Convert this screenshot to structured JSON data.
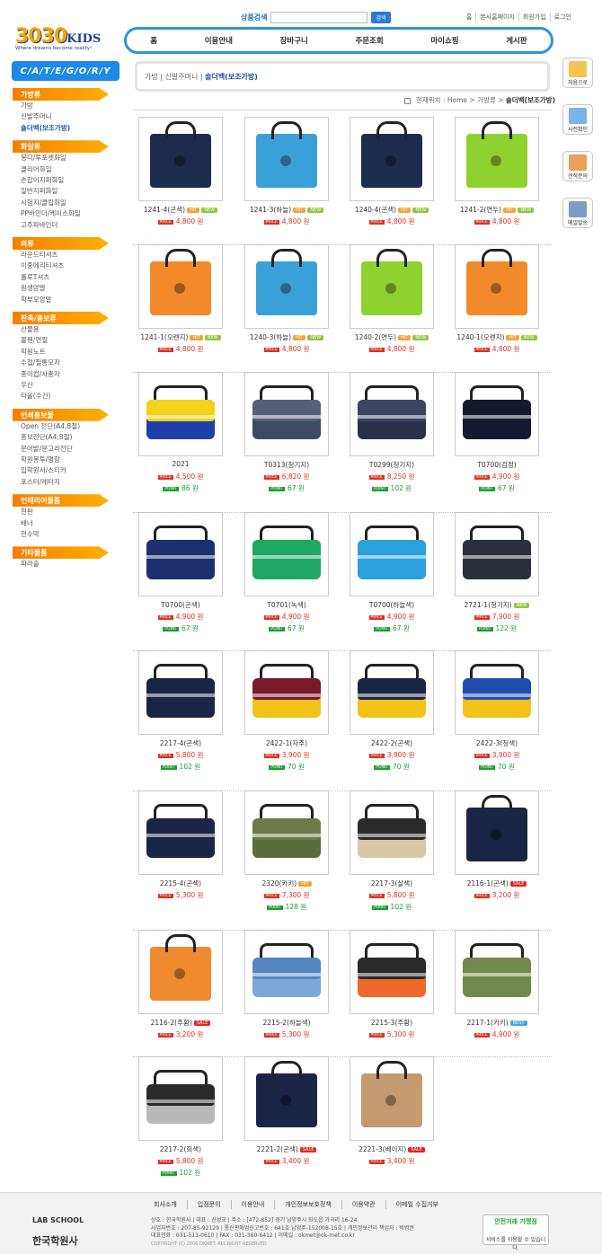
{
  "header": {
    "logo_main": "3030",
    "logo_kids": "KIDS",
    "logo_tagline": "Where dreams become reality!",
    "search_label": "상품검색",
    "search_button": "검색",
    "top_links": [
      "홈",
      "본사홈페이지",
      "회원가입",
      "로그인"
    ],
    "nav": [
      "홈",
      "이용안내",
      "장바구니",
      "주문조회",
      "마이쇼핑",
      "게시판"
    ]
  },
  "sidebar": {
    "category_title": "C/A/T/E/G/O/R/Y",
    "groups": [
      {
        "title": "가방류",
        "items": [
          "가방",
          "신발주머니",
          "숄더백(보조가방)"
        ]
      },
      {
        "title": "화일류",
        "items": [
          "봉디/투포켓화일",
          "클리어화일",
          "손잡이지퍼화일",
          "일반지퍼화일",
          "시험지/클립화일",
          "PP바인더/케이스화일",
          "고주파바인더"
        ]
      },
      {
        "title": "의류",
        "items": [
          "라운드티셔츠",
          "이중에리티셔츠",
          "롤루T셔츠",
          "원생앙말",
          "학부모앙말"
        ]
      },
      {
        "title": "판촉/홍보류",
        "items": [
          "산물용",
          "볼펜/연필",
          "학원노트",
          "수첩/필통모자",
          "종이컵/사총자",
          "우산",
          "타올(수건)"
        ]
      },
      {
        "title": "인쇄홍보물",
        "items": [
          "Open 전단(A4,8절)",
          "홍보전단(A4,8절)",
          "문어발/문고리전단",
          "학원봉투/명함",
          "입학원서/스티커",
          "포스터/레터지"
        ]
      },
      {
        "title": "인테리어물품",
        "items": [
          "현판",
          "배너",
          "현수막"
        ]
      },
      {
        "title": "기타물품",
        "items": [
          "파라솔"
        ]
      }
    ]
  },
  "quick": [
    "처음으로",
    "사전확인",
    "견적문의",
    "메일발송"
  ],
  "location": {
    "path": "가방 | 신발주머니 |",
    "current": "숄더백(보조가방)"
  },
  "breadcrumb": {
    "label": "현재위치 :",
    "path": "Home > 가방류 >",
    "current": "숄더백(보조가방)"
  },
  "products": [
    {
      "name": "1241-4(곤색)",
      "tags": [
        "hit",
        "new"
      ],
      "price": "4,800 원",
      "color": "#1d2b4d",
      "kind": "tote"
    },
    {
      "name": "1241-3(하늘)",
      "tags": [
        "hit",
        "new"
      ],
      "price": "4,800 원",
      "color": "#3aa0d8",
      "kind": "tote"
    },
    {
      "name": "1240-4(곤색)",
      "tags": [
        "hit",
        "new"
      ],
      "price": "4,800 원",
      "color": "#1d2b4d",
      "kind": "tote"
    },
    {
      "name": "1241-2(연두)",
      "tags": [
        "hit",
        "new"
      ],
      "price": "4,800 원",
      "color": "#8fd12e",
      "kind": "tote"
    },
    {
      "name": "1241-1(오렌지)",
      "tags": [
        "hit",
        "new"
      ],
      "price": "4,800 원",
      "color": "#f28a2c",
      "kind": "tote"
    },
    {
      "name": "1240-3(하늘)",
      "tags": [
        "hit",
        "new"
      ],
      "price": "4,800 원",
      "color": "#3aa0d8",
      "kind": "tote"
    },
    {
      "name": "1240-2(연두)",
      "tags": [
        "hit",
        "new"
      ],
      "price": "4,800 원",
      "color": "#8fd12e",
      "kind": "tote"
    },
    {
      "name": "1240-1(오렌지)",
      "tags": [
        "hit",
        "new"
      ],
      "price": "4,800 원",
      "color": "#f28a2c",
      "kind": "tote"
    },
    {
      "name": "2021",
      "tags": [],
      "price": "4,500 원",
      "point": "86 원",
      "color": "#1f3fa8",
      "color2": "#f3d21c",
      "kind": "msg"
    },
    {
      "name": "T0313(청기지)",
      "tags": [],
      "price": "6,820 원",
      "point": "67 원",
      "color": "#3d4a63",
      "color2": "#555f78",
      "kind": "msg"
    },
    {
      "name": "T0299(청기지)",
      "tags": [],
      "price": "8,250 원",
      "point": "102 원",
      "color": "#2a3147",
      "color2": "#3b4460",
      "kind": "msg"
    },
    {
      "name": "T0700(검정)",
      "tags": [],
      "price": "4,900 원",
      "point": "67 원",
      "color": "#141b30",
      "color2": "#141b30",
      "kind": "msg"
    },
    {
      "name": "T0700(곤색)",
      "tags": [],
      "price": "4,900 원",
      "point": "67 원",
      "color": "#1c2f6e",
      "color2": "#1c2f6e",
      "kind": "msg"
    },
    {
      "name": "T0701(녹색)",
      "tags": [],
      "price": "4,900 원",
      "point": "67 원",
      "color": "#1fa864",
      "color2": "#1fa864",
      "kind": "msg"
    },
    {
      "name": "T0700(하늘색)",
      "tags": [],
      "price": "4,900 원",
      "point": "67 원",
      "color": "#2aa0dc",
      "color2": "#2aa0dc",
      "kind": "msg"
    },
    {
      "name": "2721-1(청기지)",
      "tags": [
        "new"
      ],
      "price": "7,900 원",
      "point": "122 원",
      "color": "#2b2f3a",
      "color2": "#2b2f3a",
      "kind": "msg"
    },
    {
      "name": "2217-4(곤색)",
      "tags": [],
      "price": "5,800 원",
      "point": "102 원",
      "color": "#1a2445",
      "color2": "#1a2445",
      "kind": "msg"
    },
    {
      "name": "2422-1(자주)",
      "tags": [],
      "price": "3,900 원",
      "point": "70 원",
      "color": "#f0c21a",
      "color2": "#7a1a2a",
      "kind": "msg"
    },
    {
      "name": "2422-2(곤색)",
      "tags": [],
      "price": "3,900 원",
      "point": "70 원",
      "color": "#f0c21a",
      "color2": "#1a2445",
      "kind": "msg"
    },
    {
      "name": "2422-3(청색)",
      "tags": [],
      "price": "3,900 원",
      "point": "70 원",
      "color": "#f0c21a",
      "color2": "#1e4db0",
      "kind": "msg"
    },
    {
      "name": "2215-4(곤색)",
      "tags": [],
      "price": "5,300 원",
      "color": "#1a2445",
      "color2": "#1a2445",
      "kind": "msg"
    },
    {
      "name": "2320(카키)",
      "tags": [
        "hit"
      ],
      "price": "7,300 원",
      "point": "128 원",
      "color": "#5c6b3c",
      "color2": "#6c7b48",
      "kind": "msg"
    },
    {
      "name": "2217-3(살색)",
      "tags": [],
      "price": "5,800 원",
      "point": "102 원",
      "color": "#d8c8a8",
      "color2": "#2a2a2a",
      "kind": "msg"
    },
    {
      "name": "2116-1(곤색)",
      "tags": [
        "sale"
      ],
      "price": "3,200 원",
      "color": "#1a2445",
      "color2": "#1a2445",
      "kind": "tote"
    },
    {
      "name": "2116-2(주황)",
      "tags": [
        "sale"
      ],
      "price": "3,200 원",
      "color": "#f08a30",
      "color2": "#f08a30",
      "kind": "tote"
    },
    {
      "name": "2215-2(하늘색)",
      "tags": [],
      "price": "5,300 원",
      "color": "#7aa8d8",
      "color2": "#5486c2",
      "kind": "msg"
    },
    {
      "name": "2215-3(주황)",
      "tags": [],
      "price": "5,300 원",
      "color": "#ee6a2a",
      "color2": "#2a2a2a",
      "kind": "msg"
    },
    {
      "name": "2217-1(카키)",
      "tags": [
        "best"
      ],
      "price": "4,900 원",
      "color": "#6f8a4a",
      "color2": "#6f8a4a",
      "kind": "msg"
    },
    {
      "name": "2217-2(회색)",
      "tags": [],
      "price": "5,800 원",
      "point": "102 원",
      "color": "#b8b8b8",
      "color2": "#2a2a2a",
      "kind": "msg"
    },
    {
      "name": "2221-2(곤색)",
      "tags": [
        "sale"
      ],
      "price": "3,400 원",
      "color": "#1a2445",
      "color2": "#1a2445",
      "kind": "tote"
    },
    {
      "name": "2221-3(베이지)",
      "tags": [
        "sale"
      ],
      "price": "3,400 원",
      "color": "#c49a70",
      "color2": "#c49a70",
      "kind": "tote"
    }
  ],
  "tag_labels": {
    "hit": "HIT",
    "new": "NEW",
    "sale": "SALE",
    "best": "BEST"
  },
  "price_label": "PRICE",
  "point_label": "POINT",
  "footer": {
    "links": [
      "회사소개",
      "입점문의",
      "이용안내",
      "개인정보보호정책",
      "이용약관",
      "이메일 수집거부"
    ],
    "info": [
      "상호 : 한국학원사 | 대표 : 신성교 | 주소 : [472-852] 경기 남양주시 화도읍 가곡리 16-24",
      "사업자번호 : 207-85-92129 | 통신판매업신고번호 : 641호 남양주-152008-15호 | 개인정보관리 책임자 : 박병권",
      "대표전화 : 031-511-0610 | FAX : 031-360-6412 | 이메일 : okmet@ok-met.co.kr",
      "COPYRIGHT (C) 2006 OKMET. ALL RIGHT RESERVED."
    ],
    "logo1": "LAB SCHOOL",
    "logo2": "한국학원사",
    "badge_title": "안전거래 가맹점",
    "badge_text": "서비스를 이용할 수 있습니다."
  }
}
